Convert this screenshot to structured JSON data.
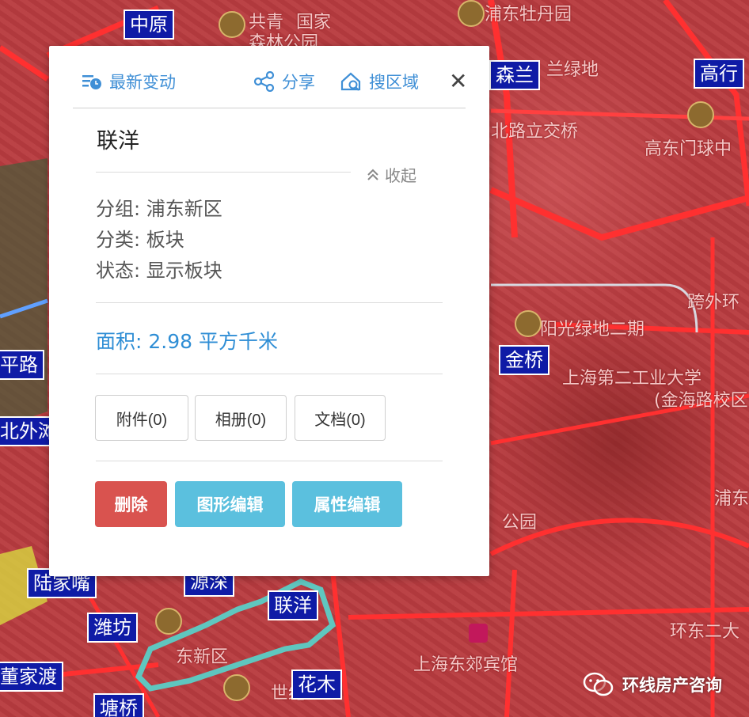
{
  "popup": {
    "toolbar": {
      "latest_changes": "最新变动",
      "share": "分享",
      "search_area": "搜区域",
      "close": "✕"
    },
    "feature_name": "联洋",
    "collapse_label": "收起",
    "attributes": [
      {
        "label": "分组:",
        "value": "浦东新区"
      },
      {
        "label": "分类:",
        "value": "板块"
      },
      {
        "label": "状态:",
        "value": "显示板块"
      }
    ],
    "area": {
      "label": "面积:",
      "value": "2.98 平方千米"
    },
    "attachment_buttons": [
      "附件(0)",
      "相册(0)",
      "文档(0)"
    ],
    "action_buttons": {
      "delete": "删除",
      "edit_shape": "图形编辑",
      "edit_attributes": "属性编辑"
    },
    "colors": {
      "delete": "#d9534f",
      "edit": "#5bc0de",
      "accent": "#2f8ed5"
    }
  },
  "map": {
    "district_labels": [
      "中原",
      "森兰",
      "高行",
      "金桥",
      "平路",
      "北外滩",
      "陆家嘴",
      "潍坊",
      "源深",
      "联洋",
      "花木",
      "董家渡",
      "塘桥"
    ],
    "place_texts": [
      "共青",
      "森林公园",
      "国家",
      "浦东牡丹园",
      "兰绿地",
      "北路立交桥",
      "高东门球中",
      "阳光绿地二期",
      "跨外环",
      "上海第二工业大学",
      "(金海路校区",
      "浦东",
      "公园",
      "上海东郊宾馆",
      "环东二大",
      "世纪",
      "东新区"
    ]
  },
  "watermark": {
    "text": "环线房产咨询"
  }
}
